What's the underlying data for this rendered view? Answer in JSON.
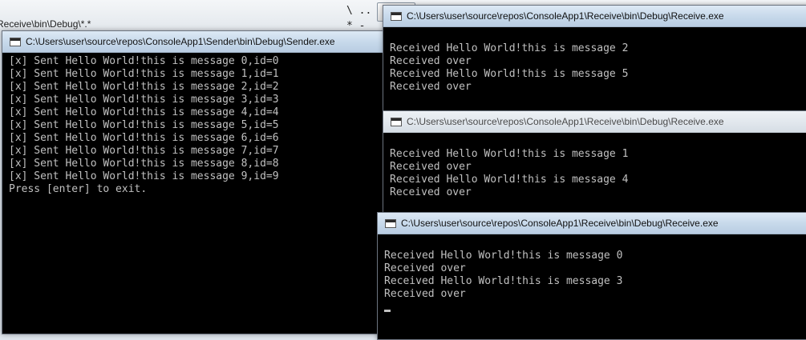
{
  "background": {
    "path_text": "Receive\\bin\\Debug\\*.*",
    "glyph_line1": "\\ ..",
    "glyph_line2": "* -"
  },
  "sender": {
    "title": "C:\\Users\\user\\source\\repos\\ConsoleApp1\\Sender\\bin\\Debug\\Sender.exe",
    "lines": [
      "[x] Sent Hello World!this is message 0,id=0",
      "[x] Sent Hello World!this is message 1,id=1",
      "[x] Sent Hello World!this is message 2,id=2",
      "[x] Sent Hello World!this is message 3,id=3",
      "[x] Sent Hello World!this is message 4,id=4",
      "[x] Sent Hello World!this is message 5,id=5",
      "[x] Sent Hello World!this is message 6,id=6",
      "[x] Sent Hello World!this is message 7,id=7",
      "[x] Sent Hello World!this is message 8,id=8",
      "[x] Sent Hello World!this is message 9,id=9",
      "Press [enter] to exit."
    ]
  },
  "receiver1": {
    "title": "C:\\Users\\user\\source\\repos\\ConsoleApp1\\Receive\\bin\\Debug\\Receive.exe",
    "lines": [
      "",
      "Received Hello World!this is message 2",
      "Received over",
      "Received Hello World!this is message 5",
      "Received over"
    ]
  },
  "receiver2": {
    "title": "C:\\Users\\user\\source\\repos\\ConsoleApp1\\Receive\\bin\\Debug\\Receive.exe",
    "lines": [
      "",
      "Received Hello World!this is message 1",
      "Received over",
      "Received Hello World!this is message 4",
      "Received over"
    ]
  },
  "receiver3": {
    "title": "C:\\Users\\user\\source\\repos\\ConsoleApp1\\Receive\\bin\\Debug\\Receive.exe",
    "lines": [
      "",
      "Received Hello World!this is message 0",
      "Received over",
      "Received Hello World!this is message 3",
      "Received over"
    ]
  },
  "colors": {
    "console_bg": "#000000",
    "console_text": "#c0c0c0",
    "titlebar_active": "#c6d8ea",
    "titlebar_inactive": "#e0e6ec"
  }
}
